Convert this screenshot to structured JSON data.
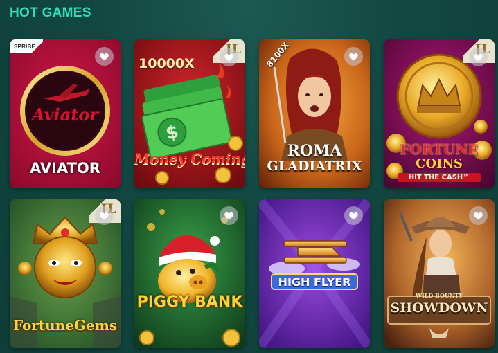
{
  "section": {
    "title": "HOT GAMES"
  },
  "colors": {
    "accent": "#2fe0bb",
    "background": "#124741"
  },
  "games": [
    {
      "title": "AVIATOR",
      "provider_badge": "SPRIBE",
      "logo_text": "Aviator",
      "favorite_icon": "heart-icon"
    },
    {
      "title": "Money Coming",
      "badge_text": "10000X",
      "jl_badge": "JL",
      "favorite_icon": "heart-icon"
    },
    {
      "title_line1": "ROMA",
      "title_line2": "GLADIATRIX",
      "badge_text": "8100X",
      "favorite_icon": "heart-icon"
    },
    {
      "title_line1": "FORTUNE",
      "title_line2": "COINS",
      "subtitle": "HIT THE CASH™",
      "jl_badge": "JL",
      "favorite_icon": "heart-icon"
    },
    {
      "title": "FortuneGems",
      "jl_badge": "JL",
      "favorite_icon": "heart-icon"
    },
    {
      "title": "PIGGY BANK",
      "favorite_icon": "heart-icon"
    },
    {
      "title": "HIGH FLYER",
      "favorite_icon": "heart-icon"
    },
    {
      "title_small": "WILD BOUNTY",
      "title": "SHOWDOWN",
      "favorite_icon": "heart-icon"
    }
  ]
}
